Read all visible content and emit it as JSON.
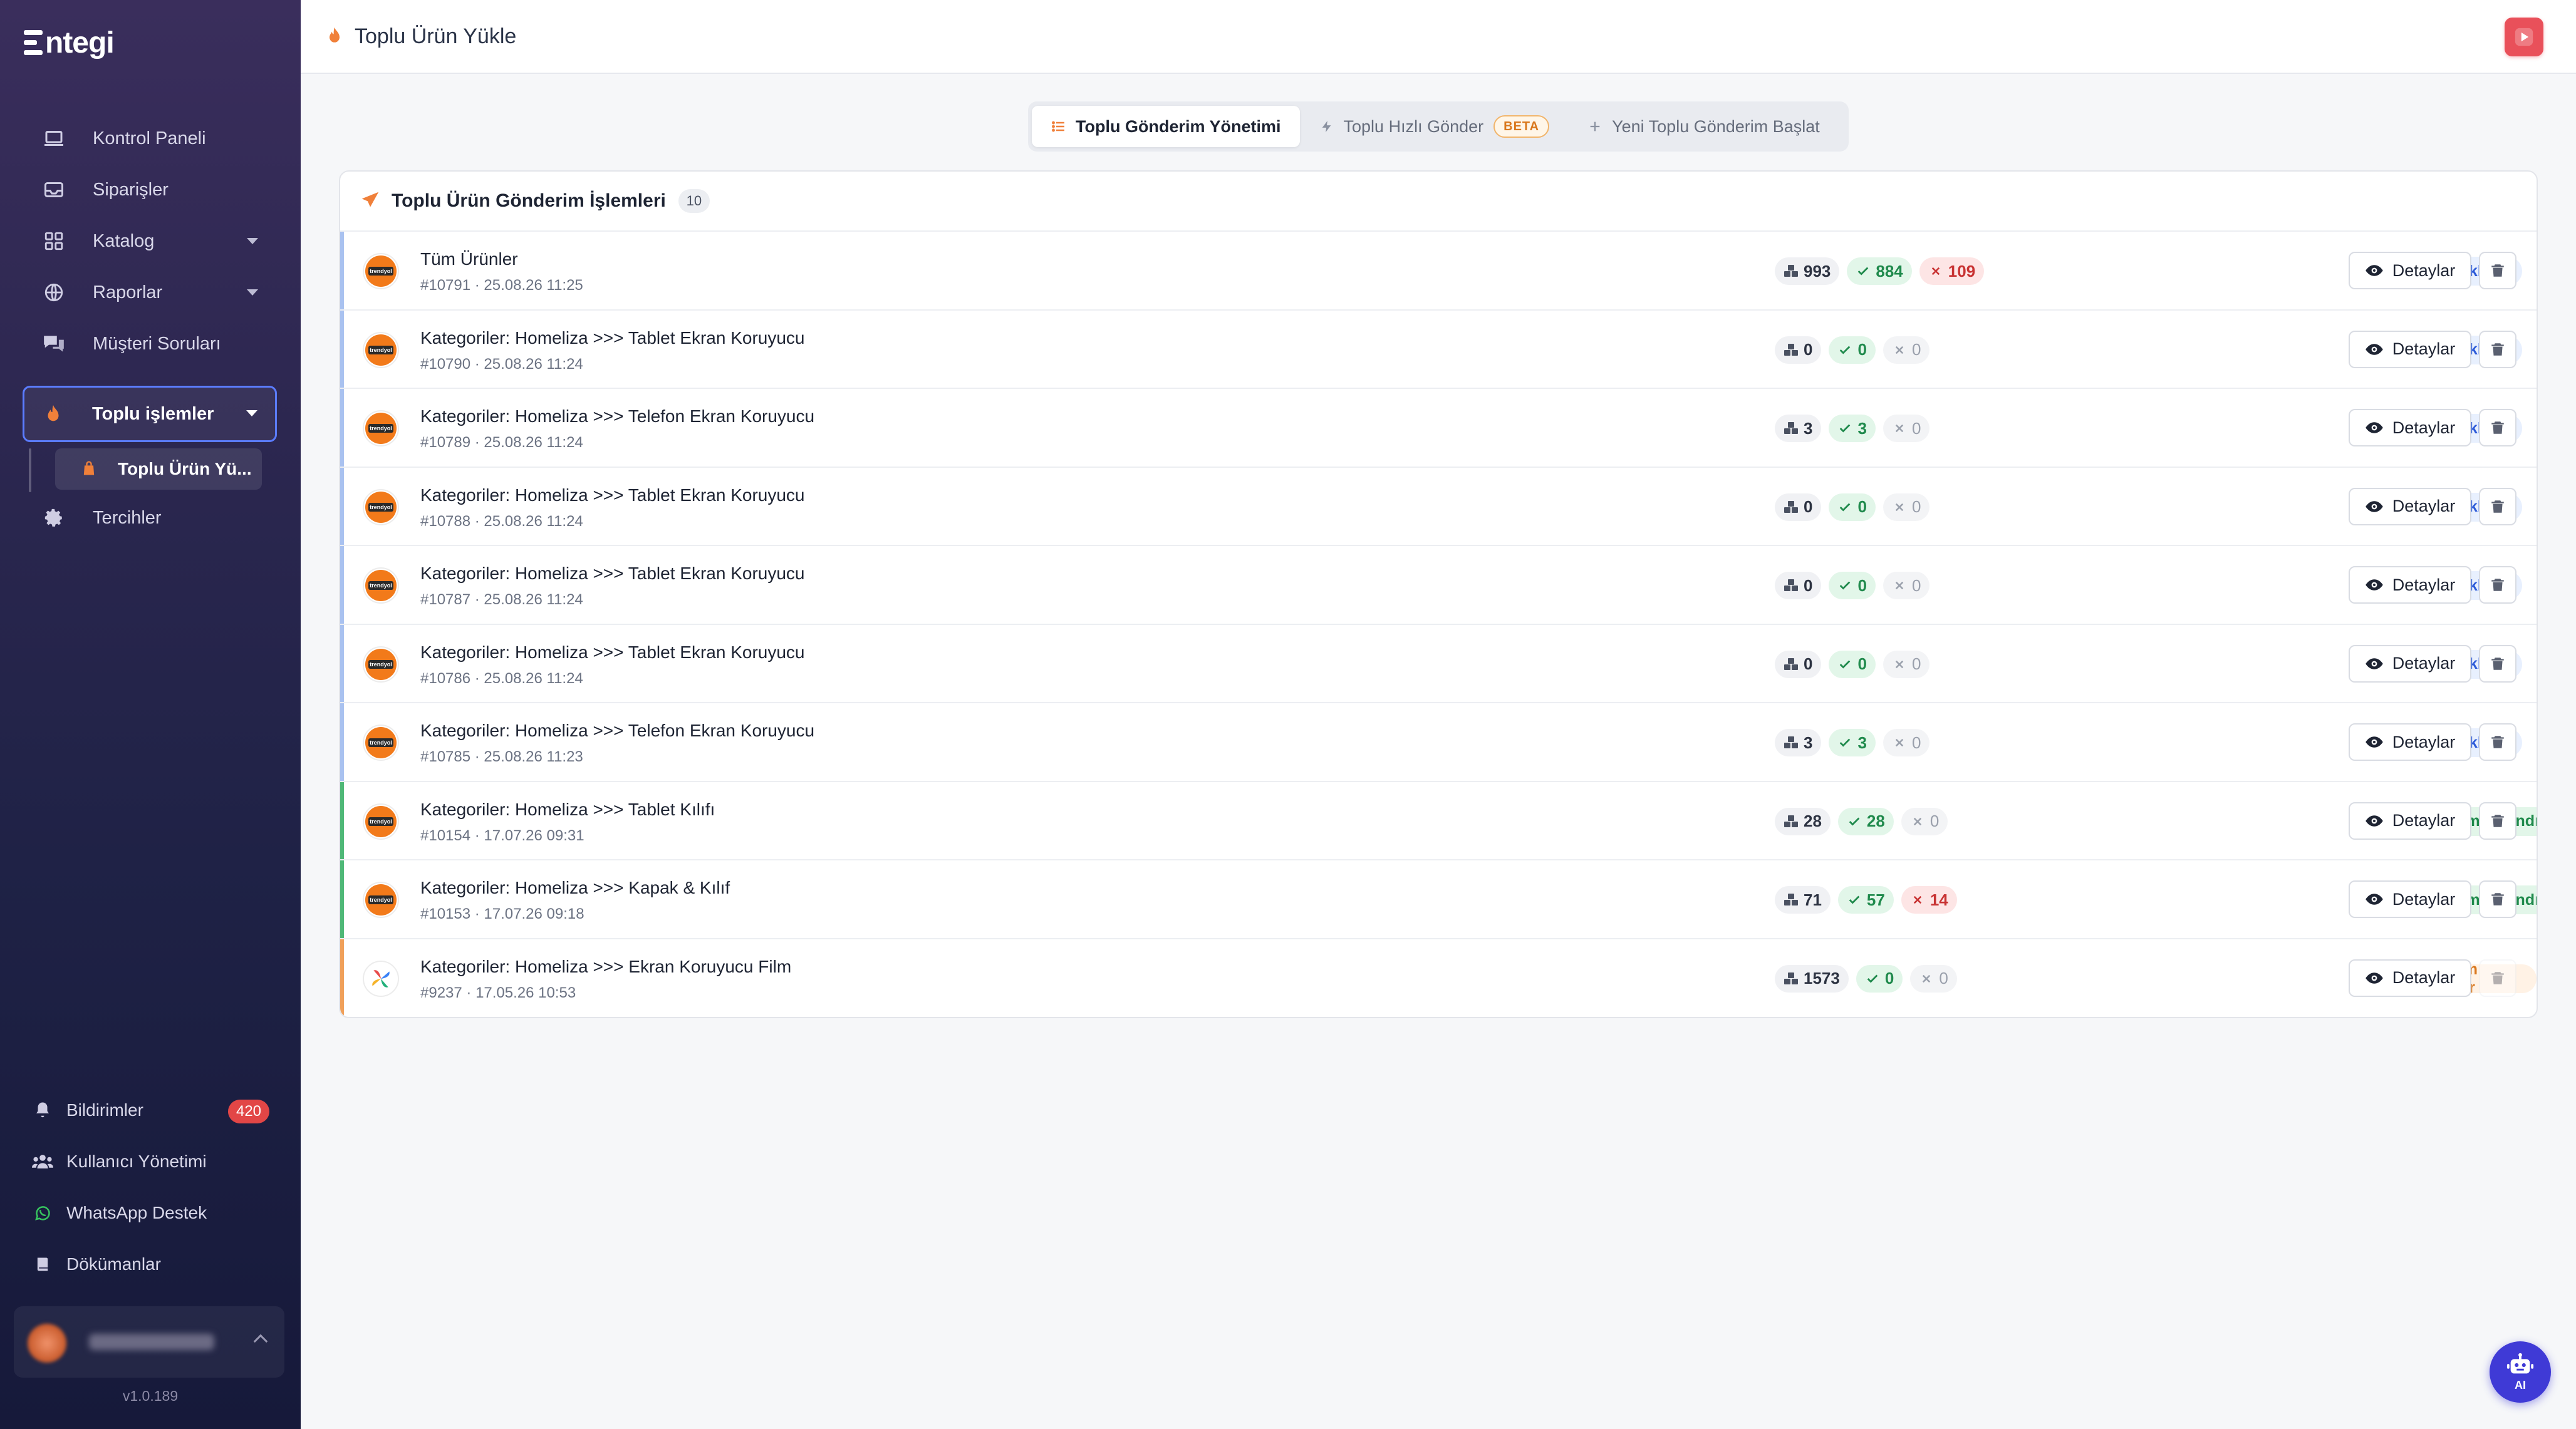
{
  "brand": {
    "name": "ntegi"
  },
  "sidebar": {
    "items": [
      {
        "label": "Kontrol Paneli",
        "icon": "laptop-icon"
      },
      {
        "label": "Siparişler",
        "icon": "inbox-icon"
      },
      {
        "label": "Katalog",
        "icon": "grid-icon"
      },
      {
        "label": "Raporlar",
        "icon": "globe-icon"
      },
      {
        "label": "Müşteri Soruları",
        "icon": "chat-icon"
      },
      {
        "label": "Toplu işlemler",
        "icon": "fire-icon"
      },
      {
        "label": "Tercihler",
        "icon": "gear-icon"
      }
    ],
    "subitem": {
      "label": "Toplu Ürün Yü..."
    },
    "bottom": [
      {
        "label": "Bildirimler",
        "icon": "bell-icon",
        "badge": "420"
      },
      {
        "label": "Kullanıcı Yönetimi",
        "icon": "users-icon"
      },
      {
        "label": "WhatsApp Destek",
        "icon": "whatsapp-icon"
      },
      {
        "label": "Dökümanlar",
        "icon": "book-icon"
      }
    ],
    "version": "v1.0.189"
  },
  "header": {
    "title": "Toplu Ürün Yükle"
  },
  "tabs": [
    {
      "label": "Toplu Gönderim Yönetimi",
      "active": true
    },
    {
      "label": "Toplu Hızlı Gönder",
      "badge": "BETA"
    },
    {
      "label": "Yeni Toplu Gönderim Başlat"
    }
  ],
  "card": {
    "title": "Toplu Ürün Gönderim İşlemleri",
    "count": "10"
  },
  "rows": [
    {
      "name": "Tüm Ürünler",
      "meta": "#10791 · 25.08.26 11:25",
      "total": "993",
      "ok": "884",
      "err": "109",
      "status": "Bekliyor",
      "kind": "wait",
      "logo": "trendyol"
    },
    {
      "name": "Kategoriler: Homeliza >>> Tablet Ekran Koruyucu",
      "meta": "#10790 · 25.08.26 11:24",
      "total": "0",
      "ok": "0",
      "err": "0",
      "status": "Bekliyor",
      "kind": "wait",
      "logo": "trendyol"
    },
    {
      "name": "Kategoriler: Homeliza >>> Telefon Ekran Koruyucu",
      "meta": "#10789 · 25.08.26 11:24",
      "total": "3",
      "ok": "3",
      "err": "0",
      "status": "Bekliyor",
      "kind": "wait",
      "logo": "trendyol"
    },
    {
      "name": "Kategoriler: Homeliza >>> Tablet Ekran Koruyucu",
      "meta": "#10788 · 25.08.26 11:24",
      "total": "0",
      "ok": "0",
      "err": "0",
      "status": "Bekliyor",
      "kind": "wait",
      "logo": "trendyol"
    },
    {
      "name": "Kategoriler: Homeliza >>> Tablet Ekran Koruyucu",
      "meta": "#10787 · 25.08.26 11:24",
      "total": "0",
      "ok": "0",
      "err": "0",
      "status": "Bekliyor",
      "kind": "wait",
      "logo": "trendyol"
    },
    {
      "name": "Kategoriler: Homeliza >>> Tablet Ekran Koruyucu",
      "meta": "#10786 · 25.08.26 11:24",
      "total": "0",
      "ok": "0",
      "err": "0",
      "status": "Bekliyor",
      "kind": "wait",
      "logo": "trendyol"
    },
    {
      "name": "Kategoriler: Homeliza >>> Telefon Ekran Koruyucu",
      "meta": "#10785 · 25.08.26 11:23",
      "total": "3",
      "ok": "3",
      "err": "0",
      "status": "Bekliyor",
      "kind": "wait",
      "logo": "trendyol"
    },
    {
      "name": "Kategoriler: Homeliza >>> Tablet Kılıfı",
      "meta": "#10154 · 17.07.26 09:31",
      "total": "28",
      "ok": "28",
      "err": "0",
      "status": "Tamamlandı",
      "kind": "done",
      "logo": "trendyol"
    },
    {
      "name": "Kategoriler: Homeliza >>> Kapak & Kılıf",
      "meta": "#10153 · 17.07.26 09:18",
      "total": "71",
      "ok": "57",
      "err": "14",
      "status": "Tamamlandı",
      "kind": "done",
      "logo": "trendyol"
    },
    {
      "name": "Kategoriler: Homeliza >>> Ekran Koruyucu Film",
      "meta": "#9237 · 17.05.26 10:53",
      "total": "1573",
      "ok": "0",
      "err": "0",
      "status": "Devam Ediyor",
      "kind": "prog",
      "logo": "pinwheel"
    }
  ],
  "actions": {
    "detail_label": "Detaylar"
  },
  "ai": {
    "label": "AI"
  },
  "colors": {
    "accent": "#5b7cff",
    "wait": "#2d5bd8",
    "done": "#1f8a4c",
    "progress": "#d9771c",
    "error": "#c83232"
  }
}
